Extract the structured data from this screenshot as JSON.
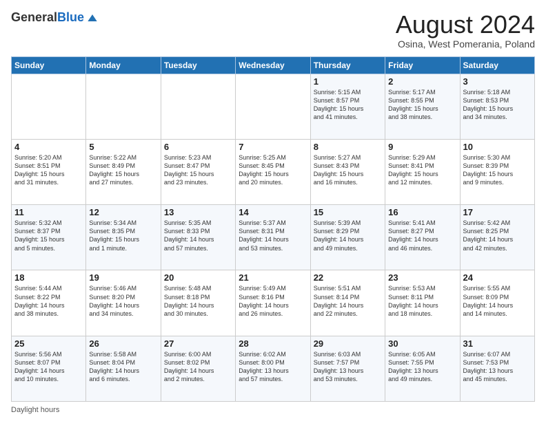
{
  "header": {
    "logo_general": "General",
    "logo_blue": "Blue",
    "month_title": "August 2024",
    "location": "Osina, West Pomerania, Poland"
  },
  "days_of_week": [
    "Sunday",
    "Monday",
    "Tuesday",
    "Wednesday",
    "Thursday",
    "Friday",
    "Saturday"
  ],
  "weeks": [
    [
      {
        "day": "",
        "info": ""
      },
      {
        "day": "",
        "info": ""
      },
      {
        "day": "",
        "info": ""
      },
      {
        "day": "",
        "info": ""
      },
      {
        "day": "1",
        "info": "Sunrise: 5:15 AM\nSunset: 8:57 PM\nDaylight: 15 hours\nand 41 minutes."
      },
      {
        "day": "2",
        "info": "Sunrise: 5:17 AM\nSunset: 8:55 PM\nDaylight: 15 hours\nand 38 minutes."
      },
      {
        "day": "3",
        "info": "Sunrise: 5:18 AM\nSunset: 8:53 PM\nDaylight: 15 hours\nand 34 minutes."
      }
    ],
    [
      {
        "day": "4",
        "info": "Sunrise: 5:20 AM\nSunset: 8:51 PM\nDaylight: 15 hours\nand 31 minutes."
      },
      {
        "day": "5",
        "info": "Sunrise: 5:22 AM\nSunset: 8:49 PM\nDaylight: 15 hours\nand 27 minutes."
      },
      {
        "day": "6",
        "info": "Sunrise: 5:23 AM\nSunset: 8:47 PM\nDaylight: 15 hours\nand 23 minutes."
      },
      {
        "day": "7",
        "info": "Sunrise: 5:25 AM\nSunset: 8:45 PM\nDaylight: 15 hours\nand 20 minutes."
      },
      {
        "day": "8",
        "info": "Sunrise: 5:27 AM\nSunset: 8:43 PM\nDaylight: 15 hours\nand 16 minutes."
      },
      {
        "day": "9",
        "info": "Sunrise: 5:29 AM\nSunset: 8:41 PM\nDaylight: 15 hours\nand 12 minutes."
      },
      {
        "day": "10",
        "info": "Sunrise: 5:30 AM\nSunset: 8:39 PM\nDaylight: 15 hours\nand 9 minutes."
      }
    ],
    [
      {
        "day": "11",
        "info": "Sunrise: 5:32 AM\nSunset: 8:37 PM\nDaylight: 15 hours\nand 5 minutes."
      },
      {
        "day": "12",
        "info": "Sunrise: 5:34 AM\nSunset: 8:35 PM\nDaylight: 15 hours\nand 1 minute."
      },
      {
        "day": "13",
        "info": "Sunrise: 5:35 AM\nSunset: 8:33 PM\nDaylight: 14 hours\nand 57 minutes."
      },
      {
        "day": "14",
        "info": "Sunrise: 5:37 AM\nSunset: 8:31 PM\nDaylight: 14 hours\nand 53 minutes."
      },
      {
        "day": "15",
        "info": "Sunrise: 5:39 AM\nSunset: 8:29 PM\nDaylight: 14 hours\nand 49 minutes."
      },
      {
        "day": "16",
        "info": "Sunrise: 5:41 AM\nSunset: 8:27 PM\nDaylight: 14 hours\nand 46 minutes."
      },
      {
        "day": "17",
        "info": "Sunrise: 5:42 AM\nSunset: 8:25 PM\nDaylight: 14 hours\nand 42 minutes."
      }
    ],
    [
      {
        "day": "18",
        "info": "Sunrise: 5:44 AM\nSunset: 8:22 PM\nDaylight: 14 hours\nand 38 minutes."
      },
      {
        "day": "19",
        "info": "Sunrise: 5:46 AM\nSunset: 8:20 PM\nDaylight: 14 hours\nand 34 minutes."
      },
      {
        "day": "20",
        "info": "Sunrise: 5:48 AM\nSunset: 8:18 PM\nDaylight: 14 hours\nand 30 minutes."
      },
      {
        "day": "21",
        "info": "Sunrise: 5:49 AM\nSunset: 8:16 PM\nDaylight: 14 hours\nand 26 minutes."
      },
      {
        "day": "22",
        "info": "Sunrise: 5:51 AM\nSunset: 8:14 PM\nDaylight: 14 hours\nand 22 minutes."
      },
      {
        "day": "23",
        "info": "Sunrise: 5:53 AM\nSunset: 8:11 PM\nDaylight: 14 hours\nand 18 minutes."
      },
      {
        "day": "24",
        "info": "Sunrise: 5:55 AM\nSunset: 8:09 PM\nDaylight: 14 hours\nand 14 minutes."
      }
    ],
    [
      {
        "day": "25",
        "info": "Sunrise: 5:56 AM\nSunset: 8:07 PM\nDaylight: 14 hours\nand 10 minutes."
      },
      {
        "day": "26",
        "info": "Sunrise: 5:58 AM\nSunset: 8:04 PM\nDaylight: 14 hours\nand 6 minutes."
      },
      {
        "day": "27",
        "info": "Sunrise: 6:00 AM\nSunset: 8:02 PM\nDaylight: 14 hours\nand 2 minutes."
      },
      {
        "day": "28",
        "info": "Sunrise: 6:02 AM\nSunset: 8:00 PM\nDaylight: 13 hours\nand 57 minutes."
      },
      {
        "day": "29",
        "info": "Sunrise: 6:03 AM\nSunset: 7:57 PM\nDaylight: 13 hours\nand 53 minutes."
      },
      {
        "day": "30",
        "info": "Sunrise: 6:05 AM\nSunset: 7:55 PM\nDaylight: 13 hours\nand 49 minutes."
      },
      {
        "day": "31",
        "info": "Sunrise: 6:07 AM\nSunset: 7:53 PM\nDaylight: 13 hours\nand 45 minutes."
      }
    ]
  ],
  "footer": {
    "daylight_hours": "Daylight hours"
  }
}
